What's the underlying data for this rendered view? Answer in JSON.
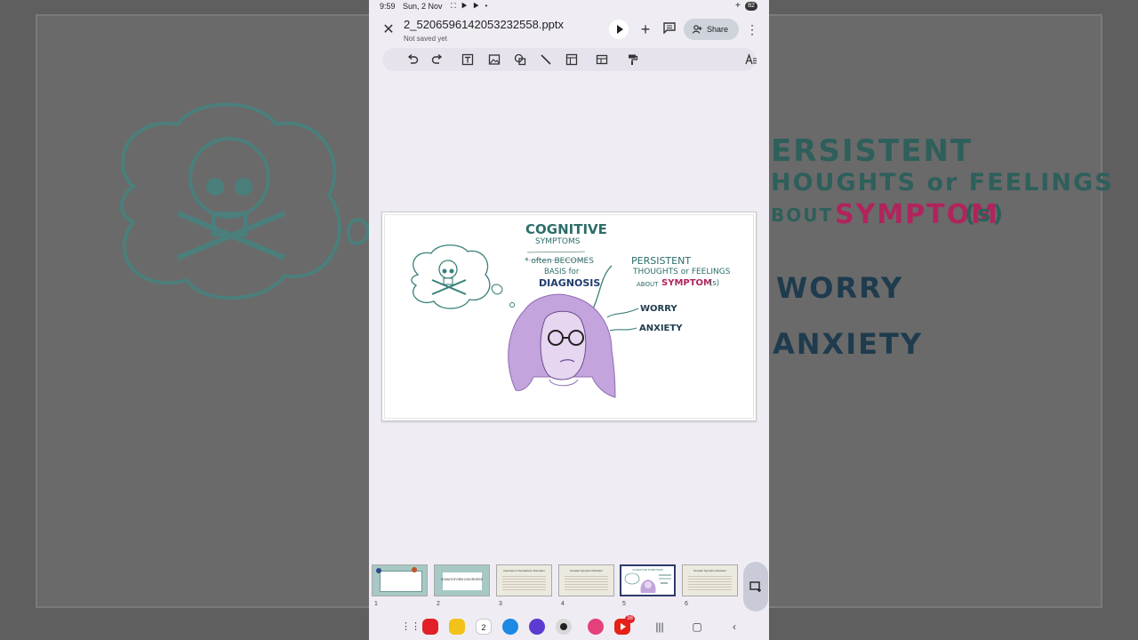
{
  "status_bar": {
    "time": "9:59",
    "date": "Sun, 2 Nov",
    "battery": "82"
  },
  "document": {
    "filename": "2_5206596142053232558.pptx",
    "save_state": "Not saved yet",
    "share_label": "Share"
  },
  "toolbar": {
    "icons": [
      "undo-icon",
      "redo-icon",
      "text-box-icon",
      "image-icon",
      "shapes-icon",
      "line-icon",
      "table-icon",
      "layout-icon",
      "paint-format-icon",
      "text-format-icon"
    ]
  },
  "slide": {
    "heading_line1": "COGNITIVE",
    "heading_line2": "SYMPTOMS",
    "note_line1": "* often BECOMES",
    "note_line2": "BASIS for",
    "note_line3": "DIAGNOSIS",
    "right_line1": "PERSISTENT",
    "right_line2": "THOUGHTS or FEELINGS",
    "right_line3_prefix": "ABOUT",
    "right_line3_highlight": "SYMPTOM",
    "right_line3_suffix": "(s)",
    "item1": "WORRY",
    "item2": "ANXIETY"
  },
  "background_zoom": {
    "line1": "ERSISTENT",
    "line2": "HOUGHTS or FEELINGS",
    "line3_prefix": "BOUT",
    "line3_highlight": "SYMPTOM",
    "line3_suffix": "(s)",
    "item1": "WORRY",
    "item2": "ANXIETY"
  },
  "thumbnails": [
    {
      "number": "1",
      "title": ""
    },
    {
      "number": "2",
      "title": "SOMATOFORM DISORDERS"
    },
    {
      "number": "3",
      "title": "Overview of Somatoform Disorders"
    },
    {
      "number": "4",
      "title": "Somatic Symptom Disorder"
    },
    {
      "number": "5",
      "title": "COGNITIVE SYMPTOMS"
    },
    {
      "number": "6",
      "title": "Somatic Symptom Disorder"
    }
  ],
  "colors": {
    "teal": "#2c6e6a",
    "navy": "#1f3b6e",
    "magenta": "#b0245c",
    "purple": "#b89ad4"
  },
  "taskbar": {
    "calendar_day": "2",
    "youtube_badge": "38"
  }
}
